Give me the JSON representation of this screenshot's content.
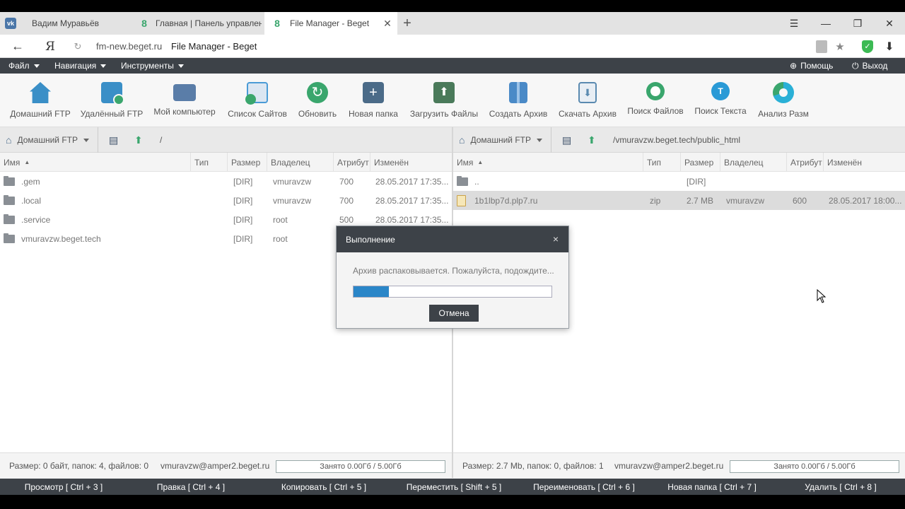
{
  "browser": {
    "tabs": [
      {
        "icon": "vk-icon",
        "label": "Вадим Муравьёв"
      },
      {
        "icon": "beget-icon",
        "label": "Главная | Панель управлен"
      },
      {
        "icon": "beget-icon",
        "label": "File Manager - Beget",
        "active": true
      }
    ],
    "new_tab": "+",
    "url_domain": "fm-new.beget.ru",
    "url_title": "File Manager - Beget"
  },
  "menu": {
    "file": "Файл",
    "nav": "Навигация",
    "tools": "Инструменты",
    "help": "Помощь",
    "exit": "Выход"
  },
  "toolbar": [
    {
      "label": "Домашний FTP",
      "icon": "home-icon",
      "color": "#3a8fc7"
    },
    {
      "label": "Удалённый FTP",
      "icon": "remote-ftp-icon",
      "color": "#3a8fc7"
    },
    {
      "label": "Мой компьютер",
      "icon": "computer-icon",
      "color": "#5a7da8"
    },
    {
      "label": "Список Сайтов",
      "icon": "sites-list-icon",
      "color": "#4a9bd6"
    },
    {
      "label": "Обновить",
      "icon": "refresh-icon",
      "color": "#3aa66d"
    },
    {
      "label": "Новая папка",
      "icon": "new-folder-icon",
      "color": "#4b6b88"
    },
    {
      "label": "Загрузить Файлы",
      "icon": "upload-icon",
      "color": "#4a7a5a"
    },
    {
      "label": "Создать Архив",
      "icon": "archive-icon",
      "color": "#4a8ac7"
    },
    {
      "label": "Скачать Архив",
      "icon": "download-archive-icon",
      "color": "#5a8ab0"
    },
    {
      "label": "Поиск Файлов",
      "icon": "search-files-icon",
      "color": "#3aa66d"
    },
    {
      "label": "Поиск Текста",
      "icon": "search-text-icon",
      "color": "#2a9ad6"
    },
    {
      "label": "Анализ Разм",
      "icon": "analysis-icon",
      "color": "#2ab0d6"
    }
  ],
  "left": {
    "source": "Домашний FTP",
    "path": "/",
    "columns": [
      "Имя",
      "Тип",
      "Размер",
      "Владелец",
      "Атрибут",
      "Изменён"
    ],
    "rows": [
      {
        "name": ".gem",
        "type": "",
        "size": "[DIR]",
        "owner": "vmuravzw",
        "attr": "700",
        "mod": "28.05.2017 17:35..."
      },
      {
        "name": ".local",
        "type": "",
        "size": "[DIR]",
        "owner": "vmuravzw",
        "attr": "700",
        "mod": "28.05.2017 17:35..."
      },
      {
        "name": ".service",
        "type": "",
        "size": "[DIR]",
        "owner": "root",
        "attr": "500",
        "mod": "28.05.2017 17:35..."
      },
      {
        "name": "vmuravzw.beget.tech",
        "type": "",
        "size": "[DIR]",
        "owner": "root",
        "attr": "",
        "mod": ""
      }
    ],
    "status": "Размер: 0 байт, папок: 4, файлов: 0",
    "account": "vmuravzw@amper2.beget.ru",
    "quota": "Занято 0.00Гб / 5.00Гб"
  },
  "right": {
    "source": "Домашний FTP",
    "path": "/vmuravzw.beget.tech/public_html",
    "columns": [
      "Имя",
      "Тип",
      "Размер",
      "Владелец",
      "Атрибут",
      "Изменён"
    ],
    "rows": [
      {
        "name": "..",
        "type": "",
        "size": "[DIR]",
        "owner": "",
        "attr": "",
        "mod": ""
      },
      {
        "name": "1b1lbp7d.plp7.ru",
        "type": "zip",
        "size": "2.7 MB",
        "owner": "vmuravzw",
        "attr": "600",
        "mod": "28.05.2017 18:00..."
      }
    ],
    "status": "Размер: 2.7 Mb, папок: 0, файлов: 1",
    "account": "vmuravzw@amper2.beget.ru",
    "quota": "Занято 0.00Гб / 5.00Гб"
  },
  "hotkeys": [
    "Просмотр [ Ctrl + 3 ]",
    "Правка [ Ctrl + 4 ]",
    "Копировать [ Ctrl + 5 ]",
    "Переместить [ Shift + 5 ]",
    "Переименовать [ Ctrl + 6 ]",
    "Новая папка [ Ctrl + 7 ]",
    "Удалить [ Ctrl + 8 ]"
  ],
  "dialog": {
    "title": "Выполнение",
    "close": "×",
    "message": "Архив распаковывается. Пожалуйста, подождите...",
    "progress": 0.18,
    "cancel": "Отмена"
  }
}
